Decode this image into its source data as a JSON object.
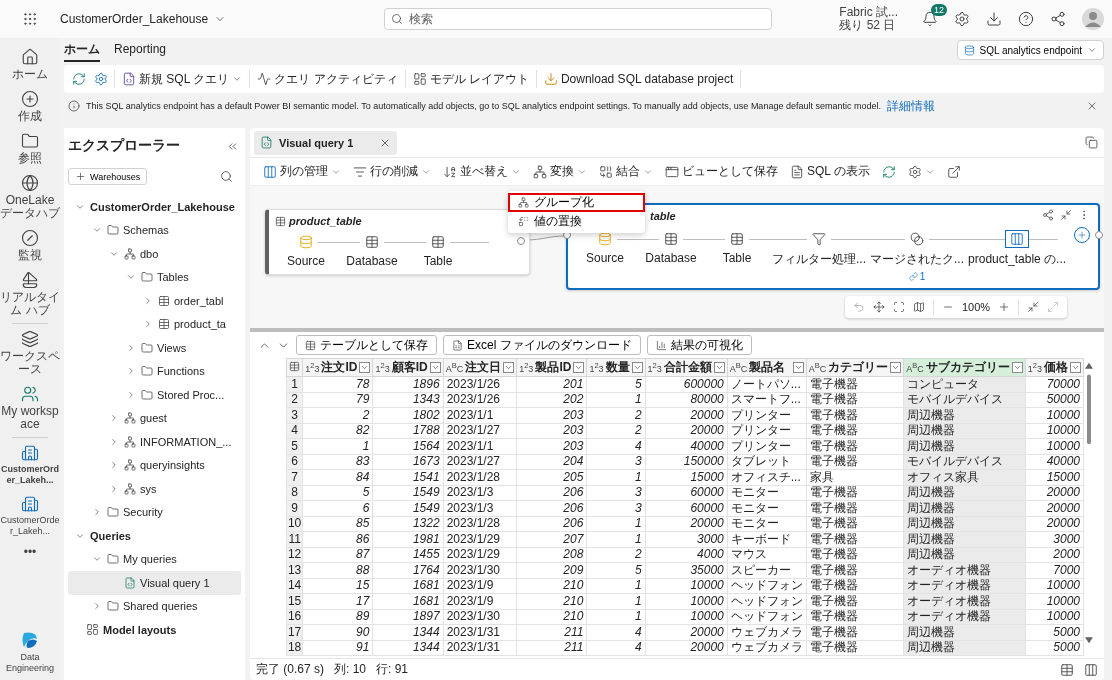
{
  "top_bar": {
    "workspace": "CustomerOrder_Lakehouse",
    "search": {
      "placeholder": "検索"
    },
    "trial": [
      "Fabric 試...",
      "残り 52 日"
    ],
    "notifications": "12"
  },
  "rail": {
    "groups": [
      [
        {
          "label": "ホーム",
          "kind": "home",
          "selected": false
        },
        {
          "label": "作成",
          "kind": "create",
          "selected": false
        },
        {
          "label": "参照",
          "kind": "browse",
          "selected": false
        },
        {
          "label": "OneLake データハブ",
          "kind": "onelake",
          "selected": false
        },
        {
          "label": "監視",
          "kind": "monitor",
          "selected": false
        },
        {
          "label": "リアルタイム ハブ",
          "kind": "realtime",
          "selected": false
        }
      ],
      [
        {
          "label": "ワークスペース",
          "kind": "workspaces",
          "selected": false
        },
        {
          "label": "My workspace",
          "kind": "myworkspace",
          "selected": false
        }
      ],
      [
        {
          "label": "CustomerOrder_Lakeh...",
          "kind": "lakehouse",
          "selected": true
        },
        {
          "label": "CustomerOrder_Lakeh...",
          "kind": "lakehouse",
          "selected": false
        },
        {
          "label": "•••",
          "kind": "more",
          "selected": false
        }
      ]
    ],
    "footer": "Data Engineering"
  },
  "ribbon": {
    "tabs": [
      {
        "label": "ホーム",
        "selected": true
      },
      {
        "label": "Reporting",
        "selected": false
      }
    ],
    "tools": [
      {
        "label": "新規 SQL クエリ",
        "kind": "sql",
        "dropdown": true
      },
      {
        "label": "クエリ アクティビティ",
        "kind": "activity",
        "dropdown": false
      },
      {
        "label": "モデル レイアウト",
        "kind": "layout",
        "dropdown": false
      },
      {
        "label": "Download SQL database project",
        "kind": "download",
        "dropdown": false
      }
    ],
    "endpoint": "SQL analytics endpoint"
  },
  "info_bar": {
    "text": "This SQL analytics endpoint has a default Power BI semantic model. To automatically add objects, go to SQL analytics endpoint settings. To manually add objects, use Manage default semantic model.",
    "link": "詳細情報"
  },
  "explorer": {
    "title": "エクスプローラー",
    "add_button": "Warehouses",
    "tree": [
      {
        "label": "CustomerOrder_Lakehouse",
        "kind": "none",
        "expanded": true,
        "selected": false,
        "children": [
          {
            "label": "Schemas",
            "kind": "folder",
            "expanded": true,
            "selected": false,
            "children": [
              {
                "label": "dbo",
                "kind": "schema",
                "expanded": true,
                "selected": false,
                "children": [
                  {
                    "label": "Tables",
                    "kind": "folder",
                    "expanded": true,
                    "selected": false,
                    "children": [
                      {
                        "label": "order_tabl",
                        "kind": "table",
                        "expanded": false,
                        "selected": false
                      },
                      {
                        "label": "product_ta",
                        "kind": "table",
                        "expanded": false,
                        "selected": false
                      }
                    ]
                  },
                  {
                    "label": "Views",
                    "kind": "folder",
                    "expanded": false,
                    "selected": false
                  },
                  {
                    "label": "Functions",
                    "kind": "folder",
                    "expanded": false,
                    "selected": false
                  },
                  {
                    "label": "Stored Proc...",
                    "kind": "folder",
                    "expanded": false,
                    "selected": false
                  }
                ]
              },
              {
                "label": "guest",
                "kind": "schema",
                "expanded": false,
                "selected": false
              },
              {
                "label": "INFORMATION_...",
                "kind": "schema",
                "expanded": false,
                "selected": false
              },
              {
                "label": "queryinsights",
                "kind": "schema",
                "expanded": false,
                "selected": false
              },
              {
                "label": "sys",
                "kind": "schema",
                "expanded": false,
                "selected": false
              }
            ]
          },
          {
            "label": "Security",
            "kind": "folder",
            "expanded": false,
            "selected": false
          }
        ]
      },
      {
        "label": "Queries",
        "kind": "none",
        "expanded": true,
        "selected": false,
        "children": [
          {
            "label": "My queries",
            "kind": "folder",
            "expanded": true,
            "selected": false,
            "children": [
              {
                "label": "Visual query 1",
                "kind": "query",
                "selected": true
              }
            ]
          },
          {
            "label": "Shared queries",
            "kind": "folder",
            "expanded": false,
            "selected": false
          }
        ]
      },
      {
        "label": "Model layouts",
        "kind": "layout",
        "selected": false
      }
    ]
  },
  "editor": {
    "tab": {
      "label": "Visual query 1",
      "selected": true
    },
    "toolbar": [
      {
        "label": "列の管理",
        "kind": "columns",
        "dropdown": true
      },
      {
        "label": "行の削減",
        "kind": "rows",
        "dropdown": true
      },
      {
        "label": "並べ替え",
        "kind": "sort",
        "dropdown": true
      },
      {
        "label": "変換",
        "kind": "transform",
        "dropdown": true
      },
      {
        "label": "結合",
        "kind": "combine",
        "dropdown": true
      },
      {
        "label": "ビューとして保存",
        "kind": "view",
        "dropdown": false
      },
      {
        "label": "SQL の表示",
        "kind": "sql",
        "dropdown": false
      },
      {
        "kind": "refresh",
        "dropdown": false
      },
      {
        "kind": "settings",
        "dropdown": true
      },
      {
        "kind": "export",
        "dropdown": false
      }
    ],
    "menu": [
      {
        "label": "グループ化",
        "kind": "group",
        "selected": true
      },
      {
        "label": "値の置換",
        "kind": "replace",
        "selected": false
      }
    ],
    "cards": [
      {
        "title": "product_table",
        "selected": false,
        "steps": [
          {
            "label": "Source",
            "kind": "source",
            "selected": false
          },
          {
            "label": "Database",
            "kind": "table",
            "selected": false
          },
          {
            "label": "Table",
            "kind": "table",
            "selected": false
          }
        ]
      },
      {
        "title": "table",
        "selected": true,
        "steps": [
          {
            "label": "Source",
            "kind": "source",
            "selected": false
          },
          {
            "label": "Database",
            "kind": "table",
            "selected": false
          },
          {
            "label": "Table",
            "kind": "table",
            "selected": false
          },
          {
            "label": "フィルター処理...",
            "kind": "filter",
            "selected": false
          },
          {
            "label": "マージされたク...",
            "kind": "merge",
            "selected": false,
            "badge": "1"
          },
          {
            "label": "product_table の...",
            "kind": "custom",
            "selected": true
          }
        ]
      }
    ],
    "zoom": "100%",
    "results": {
      "buttons": [
        {
          "label": "テーブルとして保存",
          "kind": "table"
        },
        {
          "label": "Excel ファイルのダウンロード",
          "kind": "excel"
        },
        {
          "label": "結果の可視化",
          "kind": "chart"
        }
      ],
      "columns": [
        {
          "name": "注文ID",
          "type": "1$^{2}$3",
          "kind": "number",
          "selected": false
        },
        {
          "name": "顧客ID",
          "type": "1$^{2}$3",
          "kind": "number",
          "selected": false
        },
        {
          "name": "注文日",
          "type": "A$^{B}$C",
          "kind": "text",
          "selected": false
        },
        {
          "name": "製品ID",
          "type": "1$^{2}$3",
          "kind": "number",
          "selected": false
        },
        {
          "name": "数量",
          "type": "1$^{2}$3",
          "kind": "number",
          "selected": false
        },
        {
          "name": "合計金額",
          "type": "1$^{2}$3",
          "kind": "number",
          "selected": false
        },
        {
          "name": "製品名",
          "type": "A$^{B}$C",
          "kind": "text",
          "selected": false
        },
        {
          "name": "カテゴリー",
          "type": "A$^{B}$C",
          "kind": "text",
          "selected": false
        },
        {
          "name": "サブカテゴリー",
          "type": "A$^{B}$C",
          "kind": "text",
          "selected": true
        },
        {
          "name": "価格",
          "type": "1$^{2}$3",
          "kind": "number",
          "selected": false
        }
      ],
      "rows": [
        {
          "n": "1",
          "cells": [
            "78",
            "1896",
            "2023/1/26",
            "201",
            "5",
            "600000",
            "ノートパソ...",
            "電子機器",
            "コンピュータ",
            "70000"
          ]
        },
        {
          "n": "2",
          "cells": [
            "79",
            "1343",
            "2023/1/26",
            "202",
            "1",
            "80000",
            "スマートフ...",
            "電子機器",
            "モバイルデバイス",
            "50000"
          ]
        },
        {
          "n": "3",
          "cells": [
            "2",
            "1802",
            "2023/1/1",
            "203",
            "2",
            "20000",
            "プリンター",
            "電子機器",
            "周辺機器",
            "10000"
          ]
        },
        {
          "n": "4",
          "cells": [
            "82",
            "1788",
            "2023/1/27",
            "203",
            "2",
            "20000",
            "プリンター",
            "電子機器",
            "周辺機器",
            "10000"
          ]
        },
        {
          "n": "5",
          "cells": [
            "1",
            "1564",
            "2023/1/1",
            "203",
            "4",
            "40000",
            "プリンター",
            "電子機器",
            "周辺機器",
            "10000"
          ]
        },
        {
          "n": "6",
          "cells": [
            "83",
            "1673",
            "2023/1/27",
            "204",
            "3",
            "150000",
            "タブレット",
            "電子機器",
            "モバイルデバイス",
            "40000"
          ]
        },
        {
          "n": "7",
          "cells": [
            "84",
            "1541",
            "2023/1/28",
            "205",
            "1",
            "15000",
            "オフィスチ...",
            "家具",
            "オフィス家具",
            "15000"
          ]
        },
        {
          "n": "8",
          "cells": [
            "5",
            "1549",
            "2023/1/3",
            "206",
            "3",
            "60000",
            "モニター",
            "電子機器",
            "周辺機器",
            "20000"
          ]
        },
        {
          "n": "9",
          "cells": [
            "6",
            "1549",
            "2023/1/3",
            "206",
            "3",
            "60000",
            "モニター",
            "電子機器",
            "周辺機器",
            "20000"
          ]
        },
        {
          "n": "10",
          "cells": [
            "85",
            "1322",
            "2023/1/28",
            "206",
            "1",
            "20000",
            "モニター",
            "電子機器",
            "周辺機器",
            "20000"
          ]
        },
        {
          "n": "11",
          "cells": [
            "86",
            "1981",
            "2023/1/29",
            "207",
            "1",
            "3000",
            "キーボード",
            "電子機器",
            "周辺機器",
            "3000"
          ]
        },
        {
          "n": "12",
          "cells": [
            "87",
            "1455",
            "2023/1/29",
            "208",
            "2",
            "4000",
            "マウス",
            "電子機器",
            "周辺機器",
            "2000"
          ]
        },
        {
          "n": "13",
          "cells": [
            "88",
            "1764",
            "2023/1/30",
            "209",
            "5",
            "35000",
            "スピーカー",
            "電子機器",
            "オーディオ機器",
            "7000"
          ]
        },
        {
          "n": "14",
          "cells": [
            "15",
            "1681",
            "2023/1/9",
            "210",
            "1",
            "10000",
            "ヘッドフォン",
            "電子機器",
            "オーディオ機器",
            "10000"
          ]
        },
        {
          "n": "15",
          "cells": [
            "17",
            "1681",
            "2023/1/9",
            "210",
            "1",
            "10000",
            "ヘッドフォン",
            "電子機器",
            "オーディオ機器",
            "10000"
          ]
        },
        {
          "n": "16",
          "cells": [
            "89",
            "1897",
            "2023/1/30",
            "210",
            "1",
            "10000",
            "ヘッドフォン",
            "電子機器",
            "オーディオ機器",
            "10000"
          ]
        },
        {
          "n": "17",
          "cells": [
            "90",
            "1344",
            "2023/1/31",
            "211",
            "4",
            "20000",
            "ウェブカメラ",
            "電子機器",
            "周辺機器",
            "5000"
          ]
        },
        {
          "n": "18",
          "cells": [
            "91",
            "1344",
            "2023/1/31",
            "211",
            "4",
            "20000",
            "ウェブカメラ",
            "電子機器",
            "周辺機器",
            "5000"
          ]
        }
      ]
    },
    "status": [
      "完了 (0.67 s)",
      "列: 10",
      "行: 91"
    ]
  }
}
